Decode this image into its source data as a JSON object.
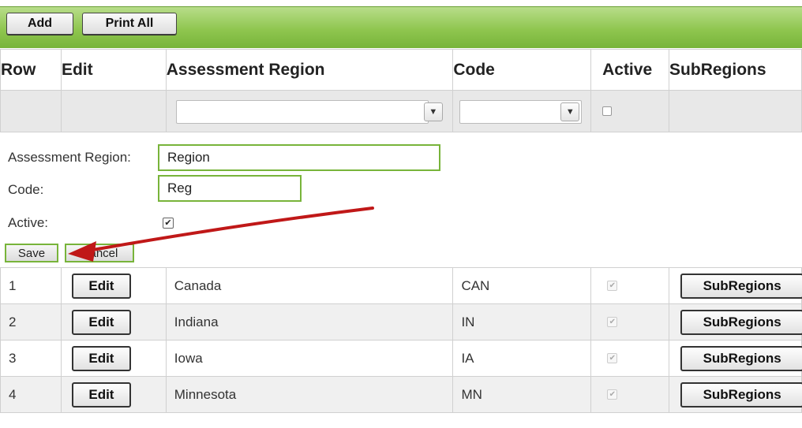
{
  "toolbar": {
    "add_label": "Add",
    "print_all_label": "Print All"
  },
  "columns": [
    "Row",
    "Edit",
    "Assessment Region",
    "Code",
    "Active",
    "SubRegions"
  ],
  "filter": {
    "region_value": "",
    "code_value": "",
    "filter_icon": "funnel-icon"
  },
  "form": {
    "region_label": "Assessment Region:",
    "region_value": "Region",
    "code_label": "Code:",
    "code_value": "Reg",
    "active_label": "Active:",
    "active_checked": true,
    "save_label": "Save",
    "cancel_label": "Cancel"
  },
  "rows": [
    {
      "row": "1",
      "edit": "Edit",
      "region": "Canada",
      "code": "CAN",
      "active": true,
      "subregions": "SubRegions"
    },
    {
      "row": "2",
      "edit": "Edit",
      "region": "Indiana",
      "code": "IN",
      "active": true,
      "subregions": "SubRegions"
    },
    {
      "row": "3",
      "edit": "Edit",
      "region": "Iowa",
      "code": "IA",
      "active": true,
      "subregions": "SubRegions"
    },
    {
      "row": "4",
      "edit": "Edit",
      "region": "Minnesota",
      "code": "MN",
      "active": true,
      "subregions": "SubRegions"
    }
  ],
  "colors": {
    "toolbar_green": "#8fc64f",
    "input_border": "#78b43a",
    "arrow_red": "#c01818"
  }
}
